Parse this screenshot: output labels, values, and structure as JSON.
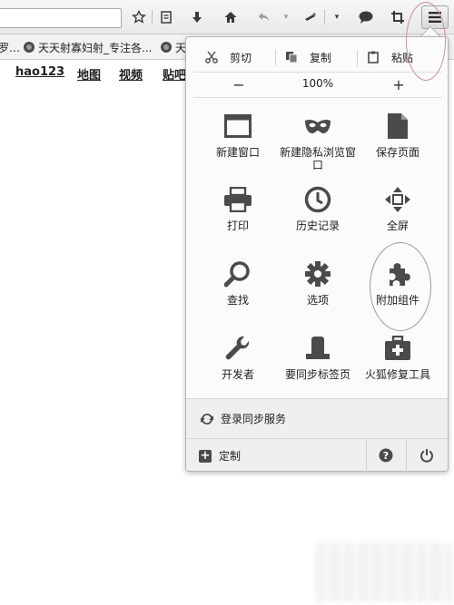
{
  "toolbar": {
    "icons": [
      "bookmark-star-icon",
      "reading-list-icon",
      "download-icon",
      "home-icon",
      "back-icon",
      "dropdown-icon",
      "camera-icon",
      "dropdown-icon",
      "chat-bubble-icon",
      "crop-icon",
      "hamburger-menu-icon"
    ]
  },
  "bookmarks": {
    "items": [
      {
        "label": "罗…"
      },
      {
        "label": "天天射寡妇射_专注各..."
      },
      {
        "label": "天"
      }
    ]
  },
  "links": {
    "items": [
      "hao123",
      "地图",
      "视频",
      "贴吧"
    ]
  },
  "menu": {
    "edit": {
      "cut": "剪切",
      "copy": "复制",
      "paste": "粘贴"
    },
    "zoom": {
      "minus": "−",
      "value": "100%",
      "plus": "+"
    },
    "grid": [
      {
        "label": "新建窗口",
        "icon": "new-window-icon"
      },
      {
        "label": "新建隐私浏览窗口",
        "icon": "private-mask-icon"
      },
      {
        "label": "保存页面",
        "icon": "save-page-icon"
      },
      {
        "label": "打印",
        "icon": "printer-icon"
      },
      {
        "label": "历史记录",
        "icon": "history-clock-icon"
      },
      {
        "label": "全屏",
        "icon": "fullscreen-icon"
      },
      {
        "label": "查找",
        "icon": "magnifier-icon"
      },
      {
        "label": "选项",
        "icon": "gear-icon"
      },
      {
        "label": "附加组件",
        "icon": "puzzle-icon"
      },
      {
        "label": "开发者",
        "icon": "wrench-icon"
      },
      {
        "label": "要同步标签页",
        "icon": "tab-sync-icon"
      },
      {
        "label": "火狐修复工具",
        "icon": "medkit-icon"
      }
    ],
    "sync": {
      "label": "登录同步服务"
    },
    "customize": {
      "label": "定制"
    }
  },
  "colors": {
    "icon": "#4b4b4b",
    "annotation_pink": "#c98ba1",
    "annotation_gray": "#9a9a9a"
  }
}
